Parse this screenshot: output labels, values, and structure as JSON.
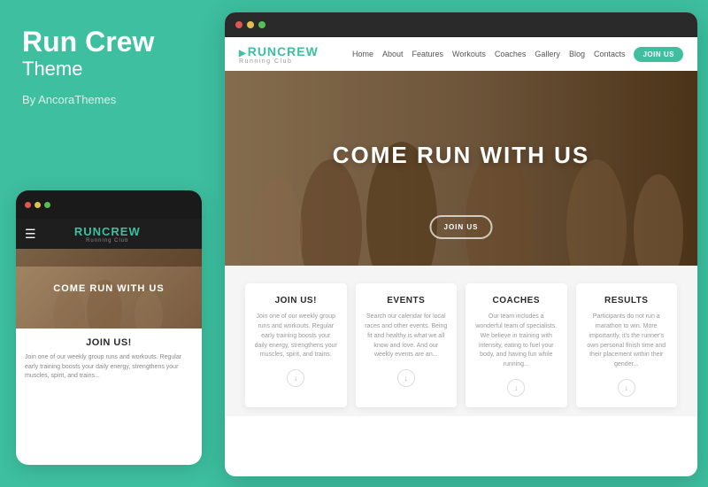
{
  "left": {
    "title": "Run Crew",
    "subtitle": "Theme",
    "by": "By AncoraThemes"
  },
  "mobile": {
    "logo_brand": "RUNCREW",
    "logo_sub": "Running Club",
    "hero_text": "COME RUN WITH US",
    "join_title": "JOIN US!",
    "join_text": "Join one of our weekly group runs and workouts. Regular early training boosts your daily energy, strengthens your muscles, spirit, and trains..."
  },
  "desktop": {
    "logo_brand": "RUNCREW",
    "logo_sub": "Running Club",
    "nav_links": [
      "Home",
      "About",
      "Features",
      "Workouts",
      "Coaches",
      "Gallery",
      "Blog",
      "Contacts"
    ],
    "join_btn": "JOIN US",
    "hero_title": "COME RUN WITH US",
    "hero_btn": "JOIN US",
    "cards": [
      {
        "title": "JOIN US!",
        "text": "Join one of our weekly group runs and workouts. Regular early training boosts your daily energy, strengthens your muscles, spirit, and trains."
      },
      {
        "title": "EVENTS",
        "text": "Search our calendar for local races and other events. Being fit and healthy is what we all know and love. And our weekly events are an..."
      },
      {
        "title": "COACHES",
        "text": "Our team includes a wonderful team of specialists. We believe in training with intensity, eating to fuel your body, and having fun while running..."
      },
      {
        "title": "RESULTS",
        "text": "Participants do not run a marathon to win. More importantly, it's the runner's own personal finish time and their placement within their gender..."
      }
    ]
  },
  "colors": {
    "teal": "#3dbfa0",
    "dark": "#1e1e1e",
    "dot_red": "#e05555",
    "dot_yellow": "#e0c055",
    "dot_green": "#55c055"
  }
}
